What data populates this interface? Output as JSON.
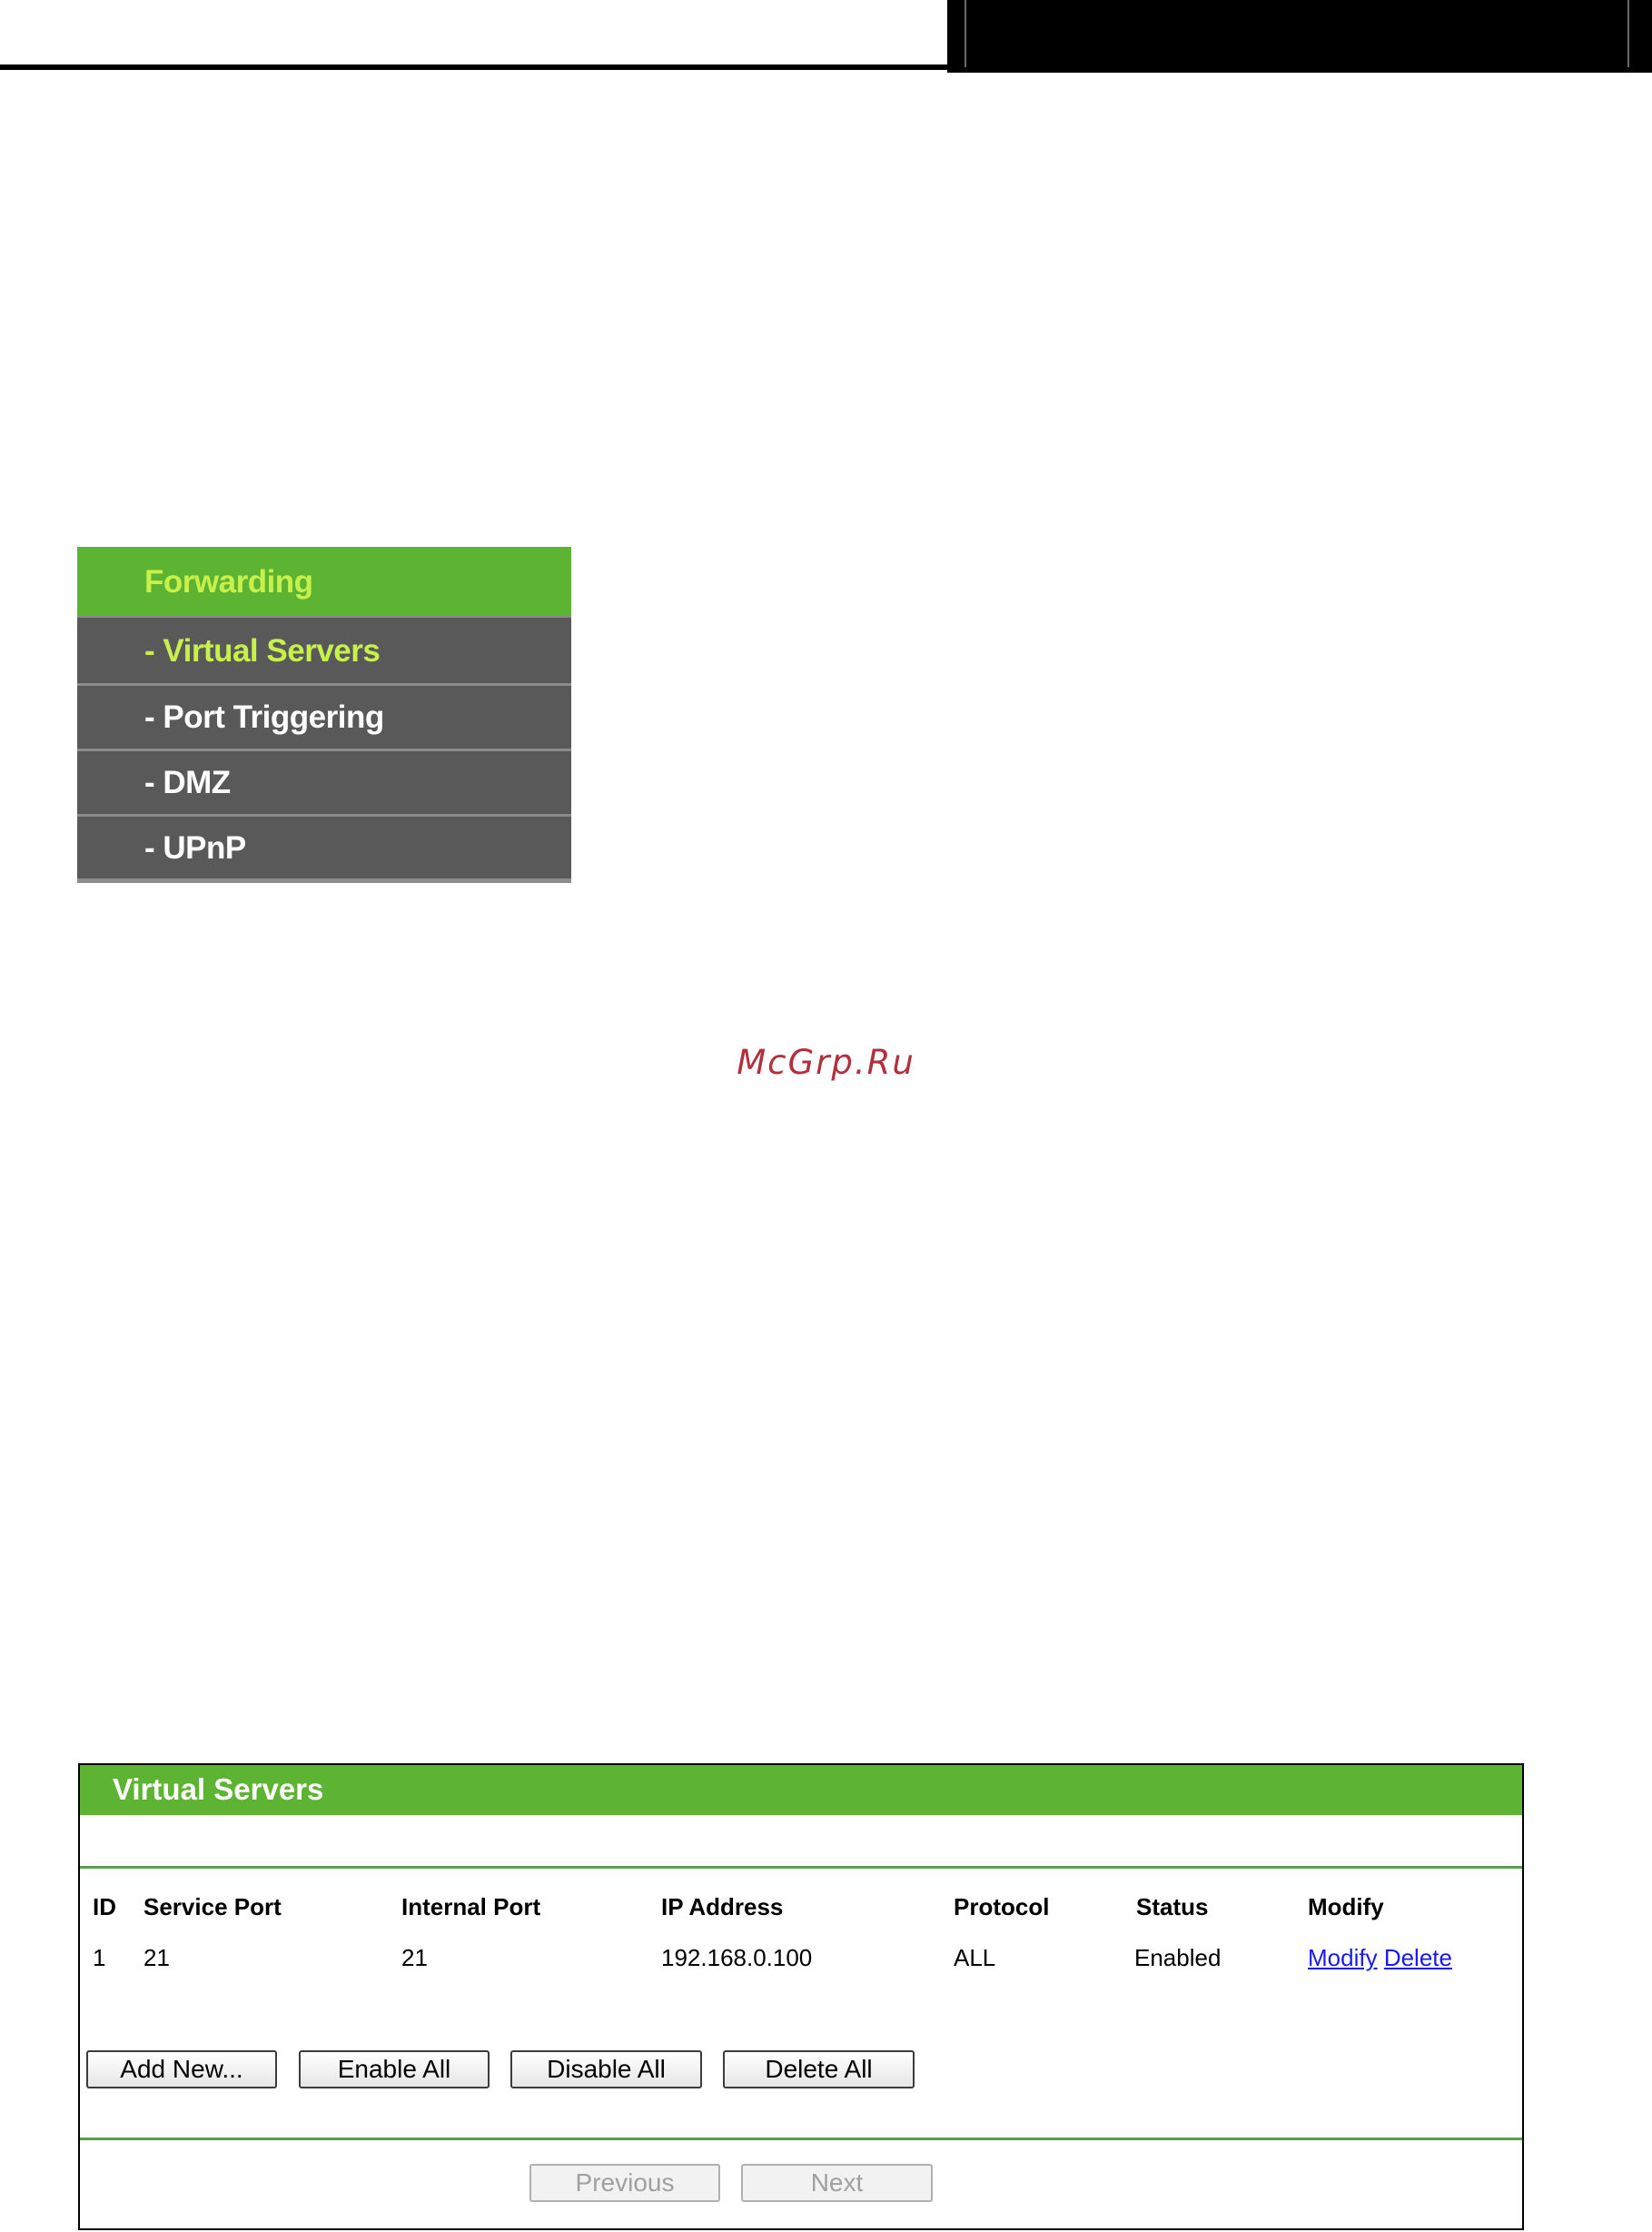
{
  "side_menu": {
    "header": "Forwarding",
    "items": [
      {
        "label": "- Virtual Servers",
        "active": true
      },
      {
        "label": "- Port Triggering",
        "active": false
      },
      {
        "label": "- DMZ",
        "active": false
      },
      {
        "label": "- UPnP",
        "active": false
      }
    ]
  },
  "watermark": "McGrp.Ru",
  "virtual_servers": {
    "title": "Virtual Servers",
    "columns": [
      "ID",
      "Service Port",
      "Internal Port",
      "IP Address",
      "Protocol",
      "Status",
      "Modify"
    ],
    "rows": [
      {
        "id": "1",
        "service_port": "21",
        "internal_port": "21",
        "ip_address": "192.168.0.100",
        "protocol": "ALL",
        "status": "Enabled",
        "modify_link": "Modify",
        "delete_link": "Delete"
      }
    ],
    "buttons": {
      "add_new": "Add New...",
      "enable_all": "Enable All",
      "disable_all": "Disable All",
      "delete_all": "Delete All",
      "previous": "Previous",
      "next": "Next"
    }
  },
  "colors": {
    "accent_green": "#5cb432",
    "menu_active_text": "#c8f04a",
    "menu_background": "#595959",
    "link_blue": "#1a1aee"
  }
}
